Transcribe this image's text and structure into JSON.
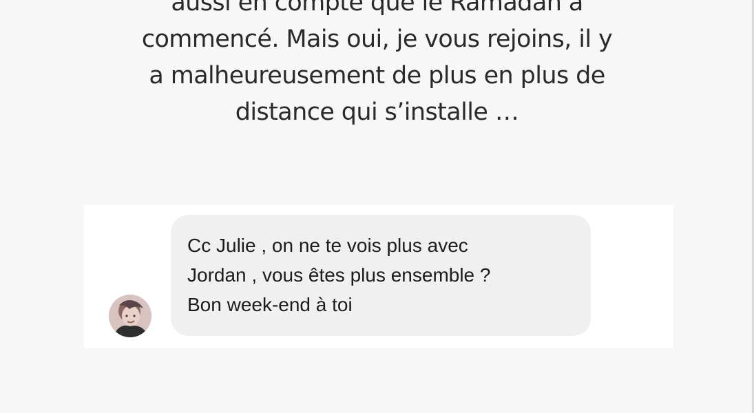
{
  "caption": {
    "lines": [
      "aussi en compte que le Ramadan a",
      "commencé. Mais oui, je vous rejoins, il y",
      "a malheureusement de plus en plus de",
      "distance qui s’installe …"
    ]
  },
  "message": {
    "avatar_icon": "profile-photo",
    "lines": [
      "Cc Julie , on ne te vois plus avec",
      "Jordan , vous êtes plus ensemble ?",
      "Bon week-end à toi"
    ],
    "bubble_color": "#f0f0f1"
  },
  "colors": {
    "background": "#f7f7f7",
    "card": "#ffffff",
    "text": "#2a2a2a"
  }
}
